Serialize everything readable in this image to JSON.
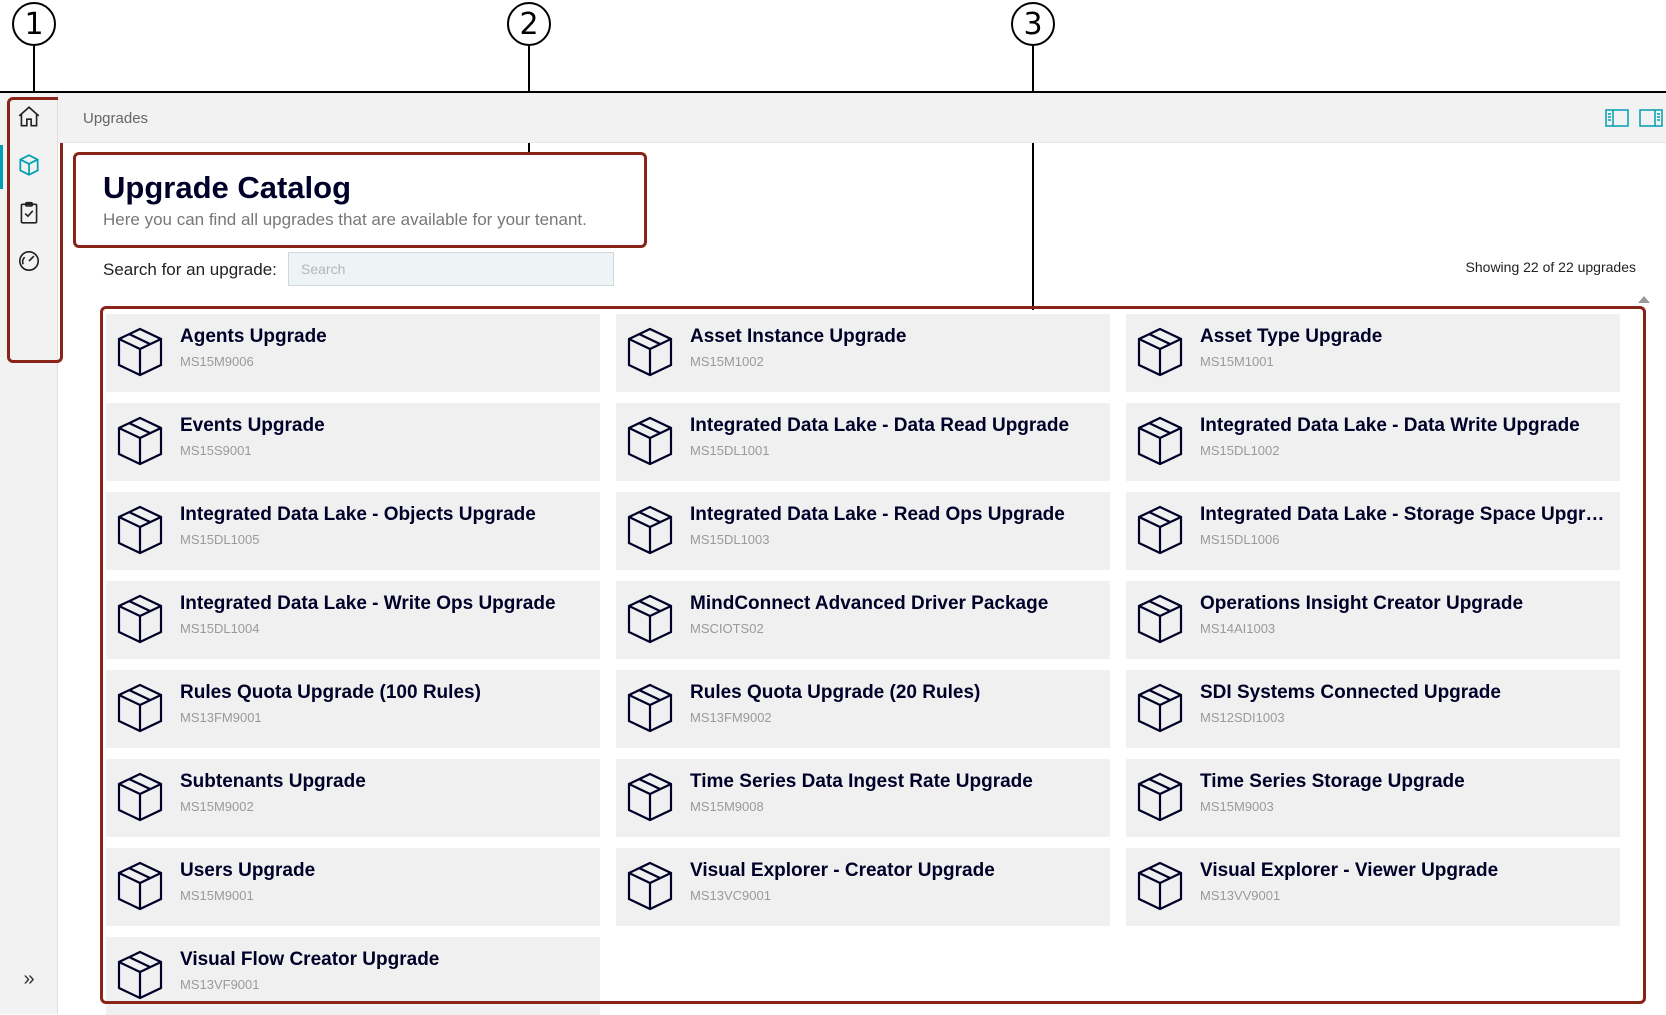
{
  "callouts": [
    "1",
    "2",
    "3"
  ],
  "breadcrumb": "Upgrades",
  "header": {
    "title": "Upgrade Catalog",
    "subtitle": "Here you can find all upgrades that are available for your tenant."
  },
  "search": {
    "label": "Search for an upgrade:",
    "placeholder": "Search",
    "value": ""
  },
  "count_text": "Showing 22 of 22 upgrades",
  "sidebar": {
    "items": [
      {
        "icon": "home-icon",
        "active": false
      },
      {
        "icon": "package-icon",
        "active": true
      },
      {
        "icon": "clipboard-check-icon",
        "active": false
      },
      {
        "icon": "speedometer-icon",
        "active": false
      }
    ],
    "expand_label": "»"
  },
  "colors": {
    "accent": "#00a0b0",
    "title": "#000028",
    "annotation_border": "#8a2318"
  },
  "upgrades": [
    {
      "name": "Agents Upgrade",
      "code": "MS15M9006"
    },
    {
      "name": "Asset Instance Upgrade",
      "code": "MS15M1002"
    },
    {
      "name": "Asset Type Upgrade",
      "code": "MS15M1001"
    },
    {
      "name": "Events Upgrade",
      "code": "MS15S9001"
    },
    {
      "name": "Integrated Data Lake - Data Read Upgrade",
      "code": "MS15DL1001"
    },
    {
      "name": "Integrated Data Lake - Data Write Upgrade",
      "code": "MS15DL1002"
    },
    {
      "name": "Integrated Data Lake - Objects Upgrade",
      "code": "MS15DL1005"
    },
    {
      "name": "Integrated Data Lake - Read Ops Upgrade",
      "code": "MS15DL1003"
    },
    {
      "name": "Integrated Data Lake - Storage Space Upgra...",
      "code": "MS15DL1006"
    },
    {
      "name": "Integrated Data Lake - Write Ops Upgrade",
      "code": "MS15DL1004"
    },
    {
      "name": "MindConnect Advanced Driver Package",
      "code": "MSCIOTS02"
    },
    {
      "name": "Operations Insight Creator Upgrade",
      "code": "MS14AI1003"
    },
    {
      "name": "Rules Quota Upgrade (100 Rules)",
      "code": "MS13FM9001"
    },
    {
      "name": "Rules Quota Upgrade (20 Rules)",
      "code": "MS13FM9002"
    },
    {
      "name": "SDI Systems Connected Upgrade",
      "code": "MS12SDI1003"
    },
    {
      "name": "Subtenants Upgrade",
      "code": "MS15M9002"
    },
    {
      "name": "Time Series Data Ingest Rate Upgrade",
      "code": "MS15M9008"
    },
    {
      "name": "Time Series Storage Upgrade",
      "code": "MS15M9003"
    },
    {
      "name": "Users Upgrade",
      "code": "MS15M9001"
    },
    {
      "name": "Visual Explorer - Creator Upgrade",
      "code": "MS13VC9001"
    },
    {
      "name": "Visual Explorer - Viewer Upgrade",
      "code": "MS13VV9001"
    },
    {
      "name": "Visual Flow Creator Upgrade",
      "code": "MS13VF9001"
    }
  ]
}
